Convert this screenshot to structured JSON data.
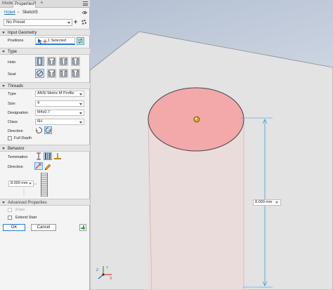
{
  "tabs": {
    "model": "Model",
    "properties": "Properties",
    "add": "+"
  },
  "breadcrumb": {
    "parent": "Hole4",
    "separator": "›",
    "current": "Sketch5"
  },
  "preset": {
    "value": "No Preset"
  },
  "sections": {
    "input_geometry": {
      "title": "Input Geometry",
      "positions_label": "Positions",
      "positions_value": "1 Selected"
    },
    "type": {
      "title": "Type",
      "hole_label": "Hole",
      "seat_label": "Seat"
    },
    "threads": {
      "title": "Threads",
      "type_label": "Type",
      "type_value": "ANSI Metric M Profile",
      "size_label": "Size",
      "size_value": "4",
      "designation_label": "Designation",
      "designation_value": "M4x0.7",
      "class_label": "Class",
      "class_value": "6H",
      "direction_label": "Direction",
      "full_depth_label": "Full Depth"
    },
    "behavior": {
      "title": "Behavior",
      "termination_label": "Termination",
      "direction_label": "Direction",
      "depth_value": "8.000 mm"
    },
    "advanced": {
      "title": "Advanced Properties",
      "iflate_label": "iFlate",
      "extend_start_label": "Extend Start"
    }
  },
  "buttons": {
    "ok": "OK",
    "cancel": "Cancel"
  },
  "viewport": {
    "dimension_value": "8.000 mm"
  },
  "colors": {
    "accent": "#2e7bcf",
    "hole_fill": "#f3a9a9",
    "viewport_top": "#b6c1d4",
    "viewport_bottom": "#f3f4f7",
    "dimension_line": "#2e8fd8"
  },
  "icons": [
    "eye-icon",
    "menu-icon",
    "plus-icon",
    "gear-icon",
    "cursor-icon",
    "sketch-point-icon",
    "swap-icon",
    "simple-hole-icon",
    "counterbore-icon",
    "spotface-icon",
    "countersink-icon",
    "no-seat-icon",
    "thread-direction-right-icon",
    "thread-direction-left-icon",
    "distance-termination-icon",
    "through-termination-icon",
    "to-termination-icon",
    "flip-direction-icon",
    "pencil-icon",
    "view-triad-icon"
  ]
}
